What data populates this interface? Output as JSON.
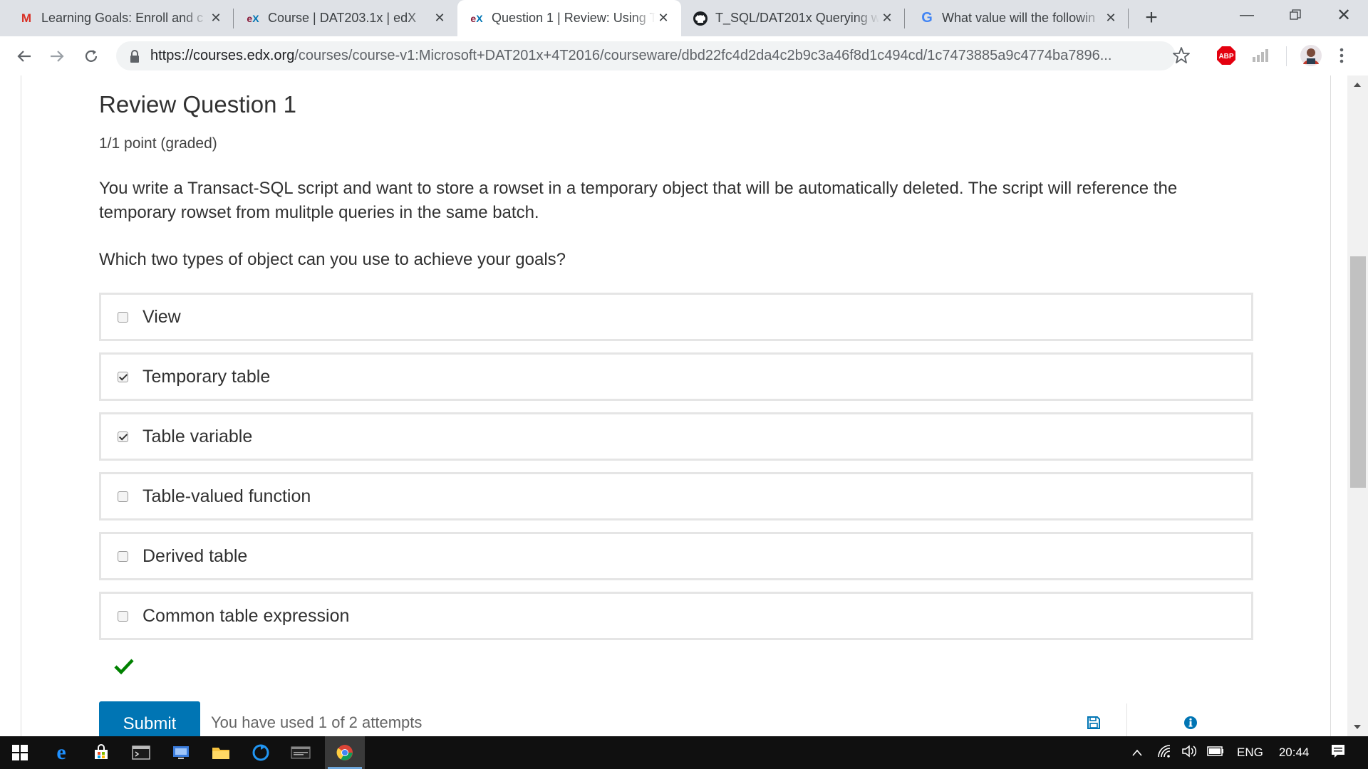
{
  "browser": {
    "tabs": [
      {
        "title": "Learning Goals: Enroll and c",
        "favicon": "gmail-icon",
        "active": false
      },
      {
        "title": "Course | DAT203.1x | edX",
        "favicon": "edx-icon",
        "active": false
      },
      {
        "title": "Question 1 | Review: Using T",
        "favicon": "edx-icon",
        "active": true
      },
      {
        "title": "T_SQL/DAT201x Querying w",
        "favicon": "github-icon",
        "active": false
      },
      {
        "title": "What value will the followin",
        "favicon": "google-icon",
        "active": false
      }
    ],
    "url_host": "https://courses.edx.org",
    "url_path": "/courses/course-v1:Microsoft+DAT201x+4T2016/courseware/dbd22fc4d2da4c2b9c3a46f8d1c494cd/1c7473885a9c4774ba7896...",
    "extension_abp": "ABP"
  },
  "problem": {
    "title": "Review Question 1",
    "points": "1/1 point (graded)",
    "prompt": "You write a Transact-SQL script and want to store a rowset in a temporary object that will be automatically deleted. The script will reference the temporary rowset from mulitple queries in the same batch.",
    "question": "Which two types of object can you use to achieve your goals?",
    "choices": [
      {
        "label": "View",
        "checked": false
      },
      {
        "label": "Temporary table",
        "checked": true
      },
      {
        "label": "Table variable",
        "checked": true
      },
      {
        "label": "Table-valued function",
        "checked": false
      },
      {
        "label": "Derived table",
        "checked": false
      },
      {
        "label": "Common table expression",
        "checked": false
      }
    ],
    "status": "correct",
    "submit_label": "Submit",
    "attempts_text": "You have used 1 of 2 attempts"
  },
  "taskbar": {
    "language": "ENG",
    "time": "20:44"
  },
  "colors": {
    "submit": "#0075b4",
    "correct": "#008100",
    "info": "#0075b4"
  }
}
